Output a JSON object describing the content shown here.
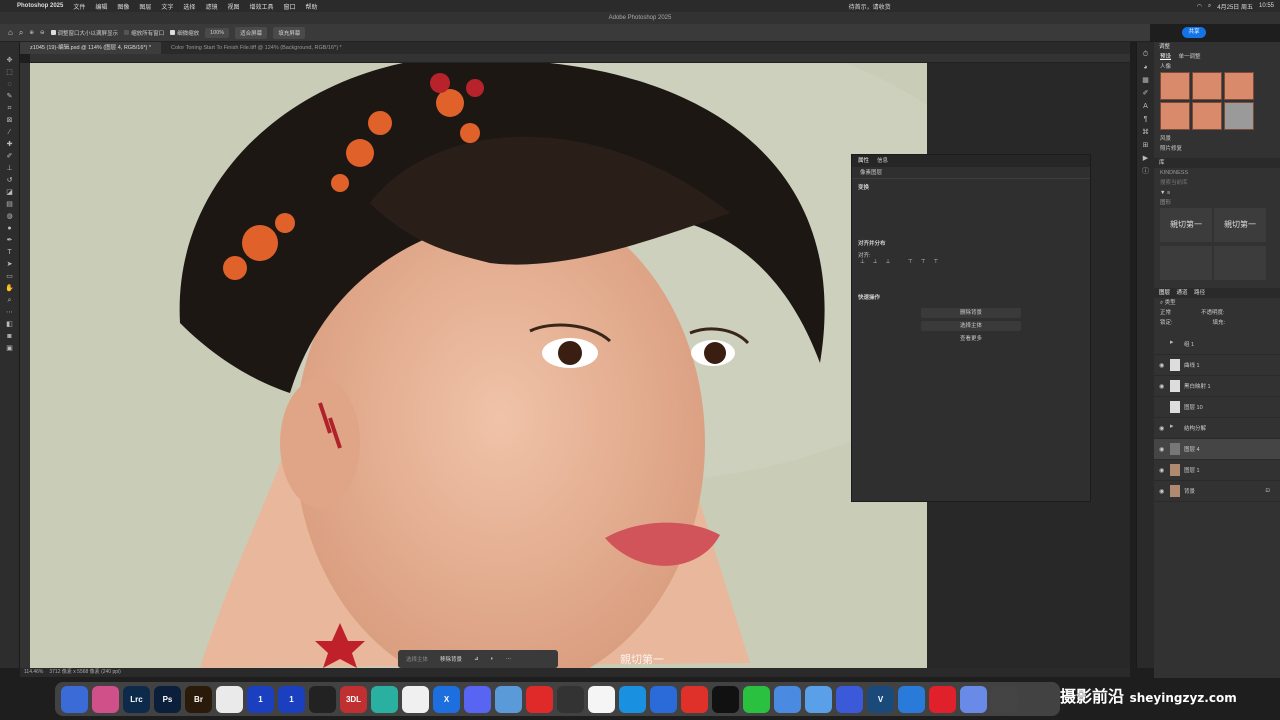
{
  "menubar": {
    "app": "Photoshop 2025",
    "items": [
      "文件",
      "编辑",
      "图像",
      "图层",
      "文字",
      "选择",
      "滤镜",
      "视图",
      "增效工具",
      "窗口",
      "帮助"
    ],
    "center_text": "待首示，请收货",
    "date": "4月25日 周五",
    "time": "10:55"
  },
  "titlebar": {
    "title": "Adobe Photoshop 2025"
  },
  "options": {
    "chk1": "调整窗口大小以满屏显示",
    "chk2": "缩放所有窗口",
    "chk3": "细微缩放",
    "zoom": "100%",
    "fit": "适合屏幕",
    "fill": "填充屏幕",
    "share": "共享"
  },
  "tabs": [
    {
      "label": "z1045 (19)-编辑.psd @ 114% (图层 4, RGB/16*) *"
    },
    {
      "label": "Color Toning Start To Finish File.tiff @ 124% (Background, RGB/16*) *"
    }
  ],
  "status": {
    "zoom": "114.46%",
    "info": "3712 像素 x 5568 像素 (240 ppi)"
  },
  "ctxbar": {
    "select_subject": "选择主体",
    "remove_bg": "移除背景"
  },
  "canvas_watermark": "親切第一",
  "properties": {
    "tab1": "属性",
    "tab2": "信息",
    "sub": "像素图层",
    "transform": "变换",
    "align": "对齐并分布",
    "align_sub": "对齐:",
    "quick": "快速操作",
    "btn1": "删除背景",
    "btn2": "选择主体",
    "btn3": "查看更多"
  },
  "rightpanel": {
    "adjust_title": "调整",
    "presets": "预设",
    "single": "单一调整",
    "portrait": "人像",
    "landscape": "风景",
    "photo_repair": "照片修复",
    "library": "库",
    "kindness": "KINDNESS",
    "search_ph": "搜索当前库",
    "graphics": "图形",
    "lib_text": "親切第一",
    "layers_tab": "图层",
    "channels_tab": "通道",
    "paths_tab": "路径",
    "kind": "类型",
    "blend": "正常",
    "opacity_label": "不透明度:",
    "lock_label": "锁定:",
    "fill_label": "填充:"
  },
  "layers": [
    {
      "name": "组 1",
      "type": "folder",
      "eye": false
    },
    {
      "name": "曲线 1",
      "type": "adj",
      "eye": true
    },
    {
      "name": "黑白映射 1",
      "type": "adj",
      "eye": true
    },
    {
      "name": "图层 10",
      "type": "white",
      "eye": false
    },
    {
      "name": "结构分解",
      "type": "folder",
      "eye": true
    },
    {
      "name": "图层 4",
      "type": "gray",
      "eye": true,
      "selected": true
    },
    {
      "name": "图层 1",
      "type": "photo",
      "eye": true
    },
    {
      "name": "背景",
      "type": "photo",
      "eye": true
    }
  ],
  "dock": [
    {
      "label": "",
      "color": "#3a6bd6"
    },
    {
      "label": "",
      "color": "#d0508a"
    },
    {
      "label": "Lrc",
      "color": "#0d2a4a"
    },
    {
      "label": "Ps",
      "color": "#0b1e3a"
    },
    {
      "label": "Br",
      "color": "#2a1a0a"
    },
    {
      "label": "",
      "color": "#eaeaea"
    },
    {
      "label": "1",
      "color": "#1a3fbf"
    },
    {
      "label": "1",
      "color": "#1a3fbf"
    },
    {
      "label": "",
      "color": "#222"
    },
    {
      "label": "3DL",
      "color": "#c03030"
    },
    {
      "label": "",
      "color": "#2ab0a0"
    },
    {
      "label": "",
      "color": "#f0f0f0"
    },
    {
      "label": "X",
      "color": "#1d6fe0"
    },
    {
      "label": "",
      "color": "#5865f2"
    },
    {
      "label": "",
      "color": "#5a9ad9"
    },
    {
      "label": "",
      "color": "#e02a2a"
    },
    {
      "label": "",
      "color": "#333"
    },
    {
      "label": "",
      "color": "#f5f5f5"
    },
    {
      "label": "",
      "color": "#1a90e0"
    },
    {
      "label": "",
      "color": "#2a6ad9"
    },
    {
      "label": "",
      "color": "#e0302a"
    },
    {
      "label": "",
      "color": "#111"
    },
    {
      "label": "",
      "color": "#2ac040"
    },
    {
      "label": "",
      "color": "#4a8ae0"
    },
    {
      "label": "",
      "color": "#5aa0e8"
    },
    {
      "label": "",
      "color": "#3a5ad9"
    },
    {
      "label": "V",
      "color": "#1a4a7a"
    },
    {
      "label": "",
      "color": "#2a7ad9"
    },
    {
      "label": "",
      "color": "#e0202a"
    },
    {
      "label": "",
      "color": "#6a8ae8"
    },
    {
      "label": "",
      "color": "#444"
    }
  ],
  "watermark": {
    "cn": "摄影前沿",
    "url": "sheyingzyz.com"
  }
}
